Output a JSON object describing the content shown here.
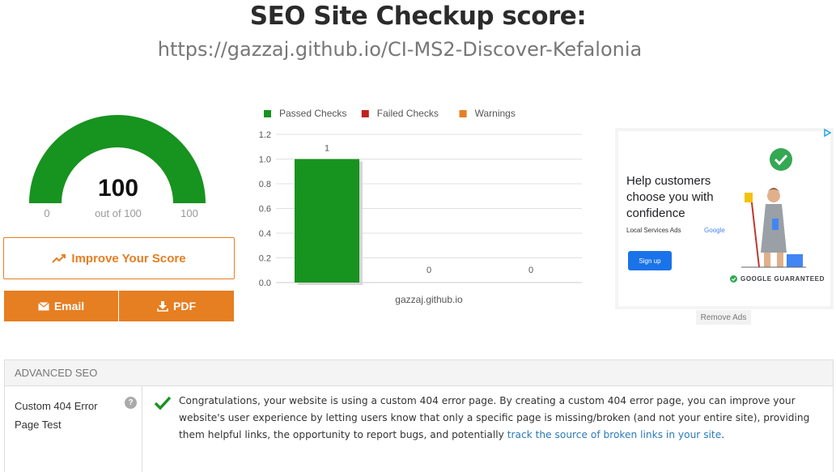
{
  "header": {
    "title": "SEO Site Checkup score:",
    "url": "https://gazzaj.github.io/CI-MS2-Discover-Kefalonia"
  },
  "gauge": {
    "score": "100",
    "min": "0",
    "max": "100",
    "subtitle": "out of 100",
    "fill_fraction": 1.0,
    "color": "#17931f"
  },
  "actions": {
    "improve_label": "Improve Your Score",
    "email_label": "Email",
    "pdf_label": "PDF",
    "accent": "#e67e22"
  },
  "chart_data": {
    "type": "bar",
    "categories": [
      "gazzaj.github.io"
    ],
    "series": [
      {
        "name": "Passed Checks",
        "values": [
          1
        ],
        "color": "#17931f"
      },
      {
        "name": "Failed Checks",
        "values": [
          0
        ],
        "color": "#c0211f"
      },
      {
        "name": "Warnings",
        "values": [
          0
        ],
        "color": "#e67e22"
      }
    ],
    "data_labels": [
      "1",
      "0",
      "0"
    ],
    "ylim": [
      0,
      1.2
    ],
    "yticks": [
      "0.0",
      "0.2",
      "0.4",
      "0.6",
      "0.8",
      "1.0",
      "1.2"
    ],
    "grid": true,
    "legend": "top"
  },
  "ad": {
    "headline": "Help customers choose you with confidence",
    "small_text": "Local Services Ads",
    "brand": "Google",
    "signup_label": "Sign up",
    "guaranteed_label": "GOOGLE GUARANTEED",
    "remove_label": "Remove Ads"
  },
  "advanced": {
    "section_title": "ADVANCED SEO",
    "rows": [
      {
        "label": "Custom 404 Error Page Test",
        "status": "passed",
        "text": "Congratulations, your website is using a custom 404 error page. By creating a custom 404 error page, you can improve your website's user experience by letting users know that only a specific page is missing/broken (and not your entire site), providing them helpful links, the opportunity to report bugs, and potentially ",
        "link_text": "track the source of broken links in your site",
        "trailing": "."
      }
    ]
  }
}
